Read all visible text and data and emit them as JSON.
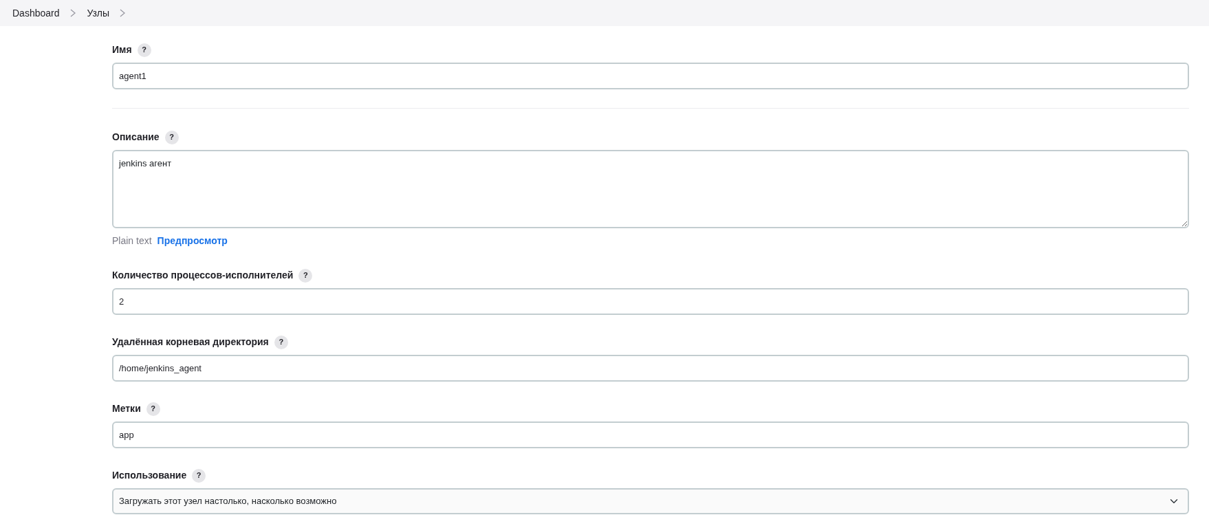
{
  "breadcrumb": [
    {
      "label": "Dashboard"
    },
    {
      "label": "Узлы"
    }
  ],
  "fields": [
    {
      "kind": "text",
      "label": "Имя",
      "help": "?",
      "value": "agent1",
      "divider_after": true
    },
    {
      "kind": "textarea",
      "label": "Описание",
      "help": "?",
      "value": "jenkins агент",
      "format": "Plain text",
      "preview": "Предпросмотр"
    },
    {
      "kind": "text",
      "label": "Количество процессов-исполнителей",
      "help": "?",
      "value": "2"
    },
    {
      "kind": "text",
      "label": "Удалённая корневая директория",
      "help": "?",
      "value": "/home/jenkins_agent"
    },
    {
      "kind": "text",
      "label": "Метки",
      "help": "?",
      "value": "app"
    },
    {
      "kind": "select",
      "label": "Использование",
      "help": "?",
      "value": "Загружать этот узел настолько, насколько возможно"
    }
  ]
}
